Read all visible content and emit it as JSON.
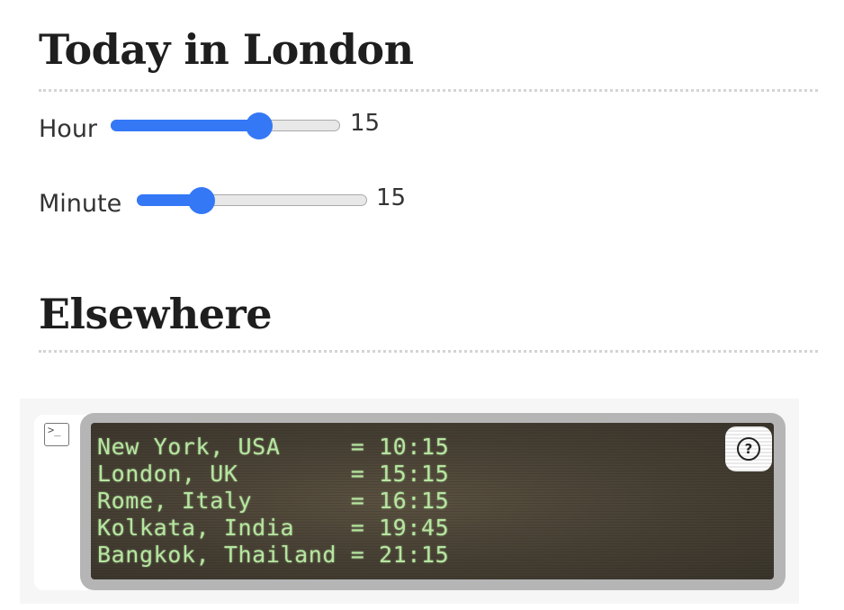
{
  "sections": {
    "today_title": "Today in London",
    "elsewhere_title": "Elsewhere"
  },
  "sliders": {
    "hour": {
      "label": "Hour",
      "value": "15",
      "min": 0,
      "max": 23,
      "fraction": 0.65
    },
    "minute": {
      "label": "Minute",
      "value": "15",
      "min": 0,
      "max": 59,
      "fraction": 0.28
    }
  },
  "console": {
    "lines": [
      "New York, USA     = 10:15",
      "London, UK        = 15:15",
      "Rome, Italy       = 16:15",
      "Kolkata, India    = 19:45",
      "Bangkok, Thailand = 21:15"
    ],
    "help_glyph": "?"
  },
  "colors": {
    "accent": "#3478f6",
    "console_text": "#b6e6a0",
    "console_bg": "#463f33"
  },
  "icons": {
    "prompt": "terminal-prompt-icon",
    "help": "question-circle-icon"
  }
}
